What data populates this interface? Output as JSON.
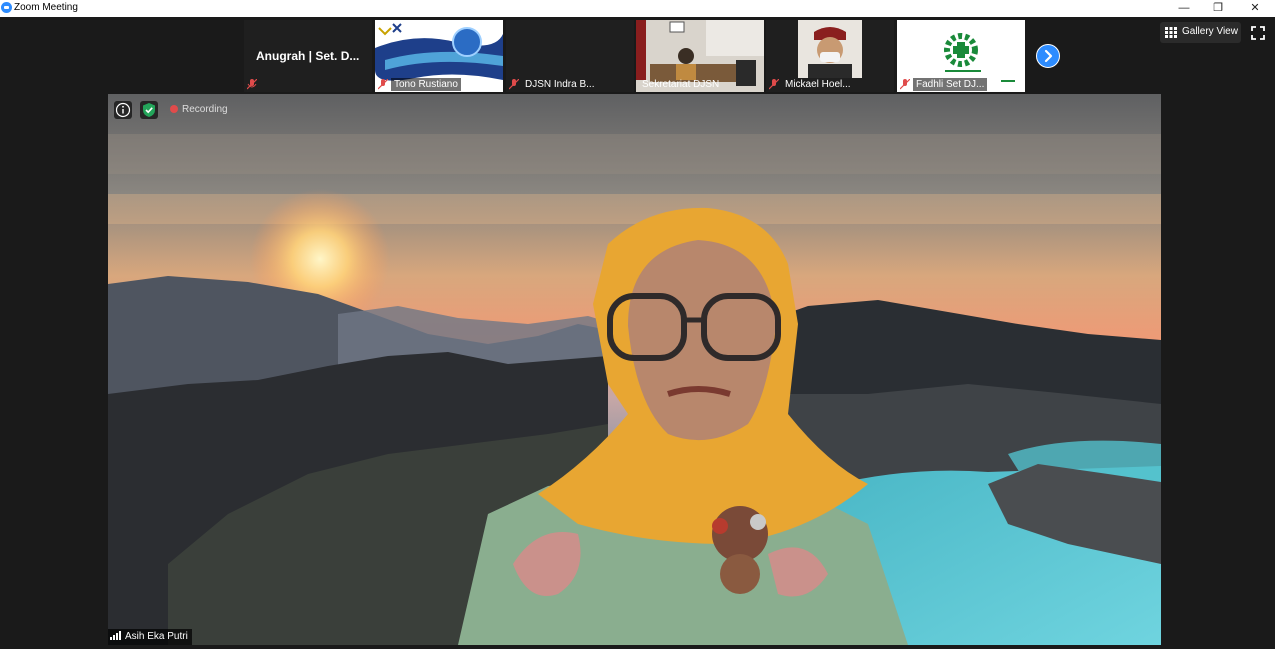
{
  "window": {
    "title": "Zoom Meeting",
    "minimize": "—",
    "restore": "❐",
    "close": "✕"
  },
  "participants_strip": {
    "first_name": "Anugrah | Set. D...",
    "tiles": [
      {
        "name": "Tono Rustiano"
      },
      {
        "name": "DJSN Indra B..."
      },
      {
        "name": "Sekretariat DJSN"
      },
      {
        "name": "Mickael Hoel..."
      },
      {
        "name": "Fadhli Set DJ..."
      }
    ],
    "next_page_icon": "chevron-right-icon"
  },
  "view_controls": {
    "gallery_view_label": "Gallery View",
    "gallery_icon": "grid-icon",
    "fullscreen_icon": "fullscreen-icon"
  },
  "main_video": {
    "recording_label": "Recording",
    "speaker_name": "Asih Eka Putri",
    "info_icon": "info-icon",
    "security_icon": "shield-icon"
  },
  "colors": {
    "accent": "#2d8cff",
    "background": "#1a1a1a",
    "recording": "#e04b4b",
    "security": "#23a55a"
  }
}
